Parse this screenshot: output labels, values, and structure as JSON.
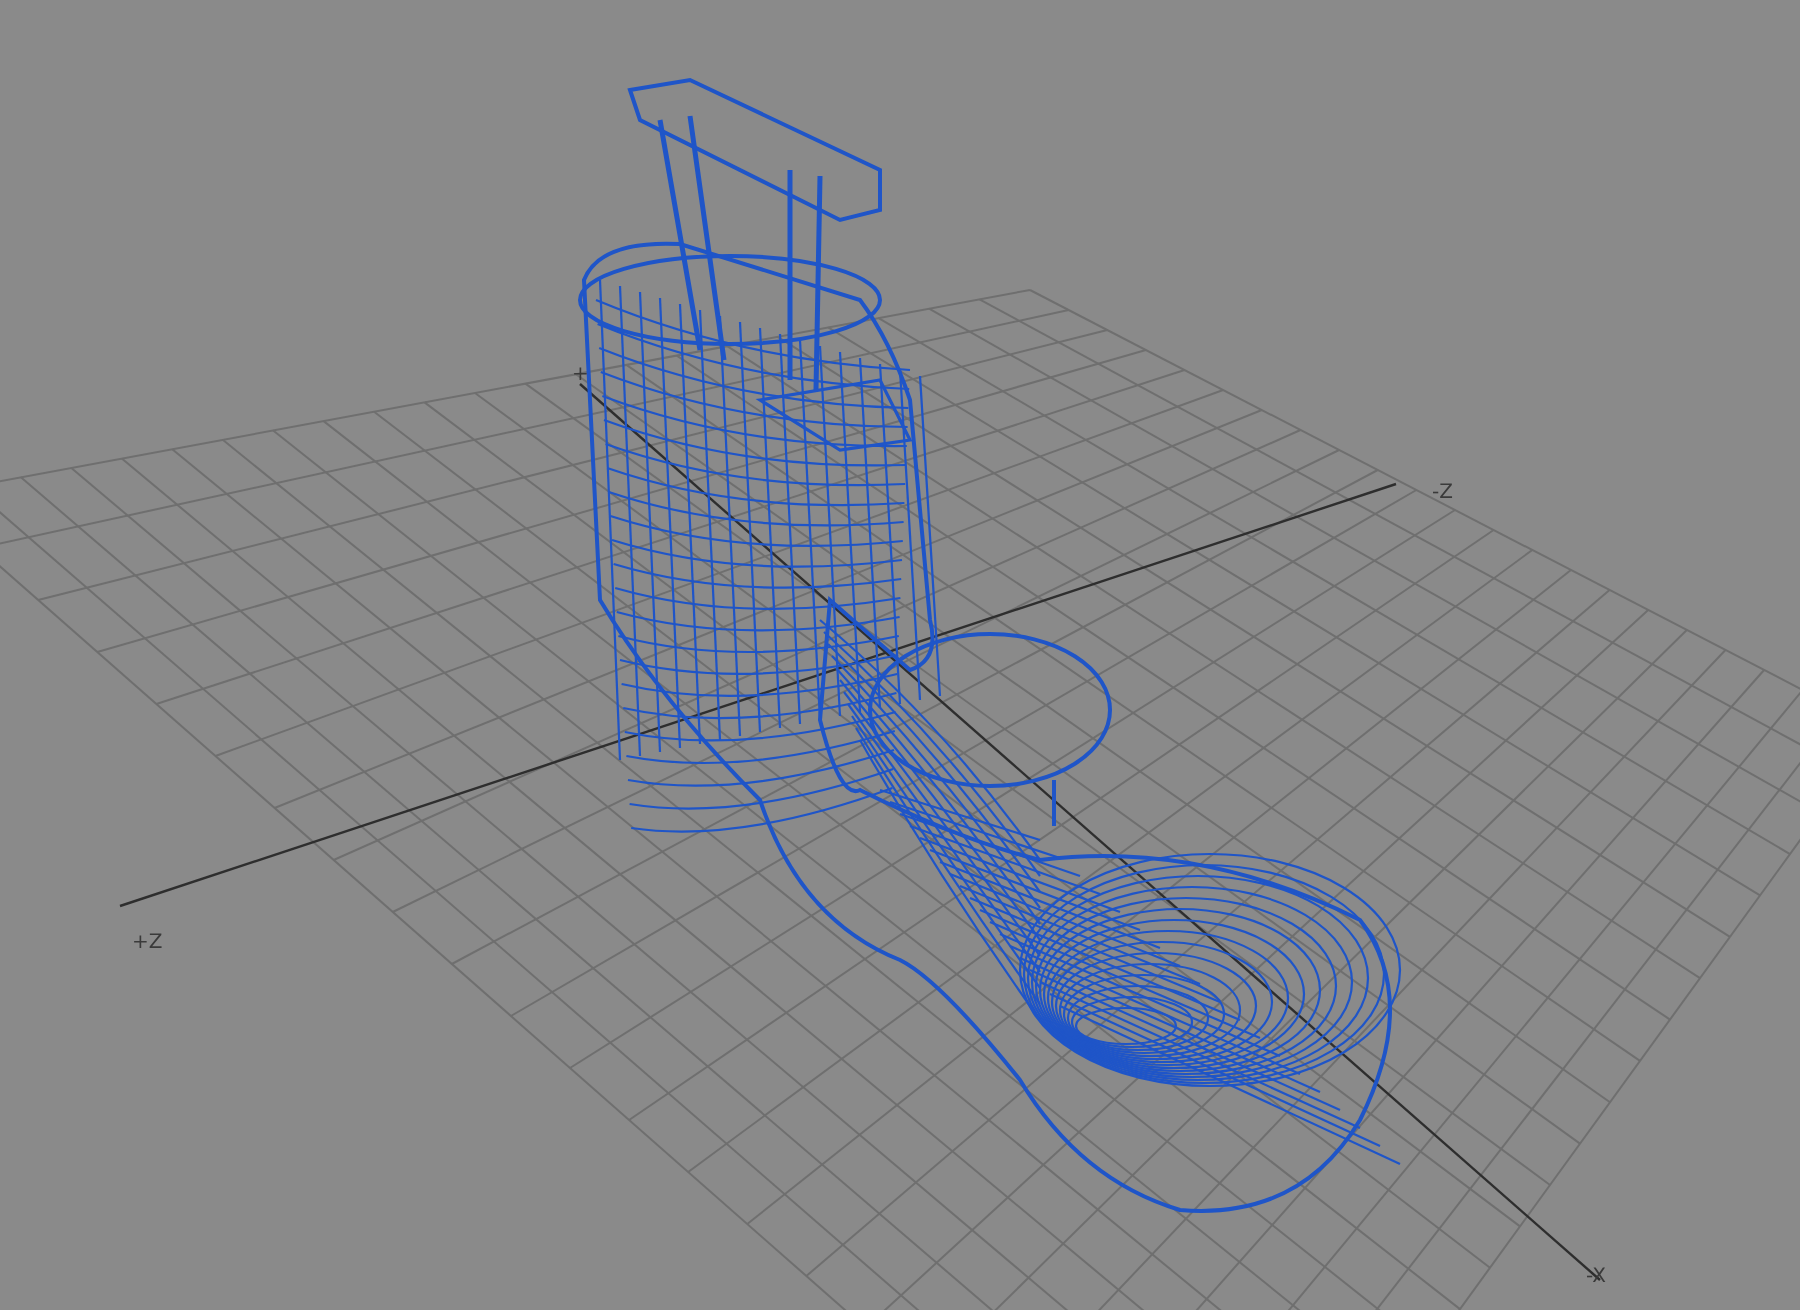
{
  "viewport": {
    "axis_labels": [
      {
        "text": "+"
      },
      {
        "text": "-Z"
      },
      {
        "text": "+Z"
      },
      {
        "text": "-X"
      }
    ]
  }
}
